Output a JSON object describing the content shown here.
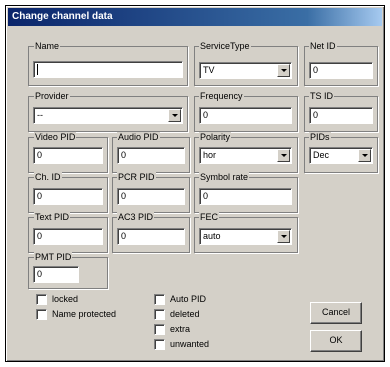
{
  "window": {
    "title": "Change channel data"
  },
  "fields": {
    "name": {
      "label": "Name",
      "value": ""
    },
    "service_type": {
      "label": "ServiceType",
      "value": "TV"
    },
    "net_id": {
      "label": "Net ID",
      "value": "0"
    },
    "provider": {
      "label": "Provider",
      "value": "--"
    },
    "frequency": {
      "label": "Frequency",
      "value": "0"
    },
    "ts_id": {
      "label": "TS ID",
      "value": "0"
    },
    "video_pid": {
      "label": "Video PID",
      "value": "0"
    },
    "audio_pid": {
      "label": "Audio PID",
      "value": "0"
    },
    "polarity": {
      "label": "Polarity",
      "value": "hor"
    },
    "pids": {
      "label": "PIDs",
      "value": "Dec"
    },
    "ch_id": {
      "label": "Ch. ID",
      "value": "0"
    },
    "pcr_pid": {
      "label": "PCR PID",
      "value": "0"
    },
    "symbol_rate": {
      "label": "Symbol rate",
      "value": "0"
    },
    "text_pid": {
      "label": "Text PID",
      "value": "0"
    },
    "ac3_pid": {
      "label": "AC3 PID",
      "value": "0"
    },
    "fec": {
      "label": "FEC",
      "value": "auto"
    },
    "pmt_pid": {
      "label": "PMT PID",
      "value": "0"
    }
  },
  "checkboxes": {
    "locked": {
      "label": "locked",
      "checked": false
    },
    "name_protected": {
      "label": "Name protected",
      "checked": false
    },
    "auto_pid": {
      "label": "Auto PID",
      "checked": false
    },
    "deleted": {
      "label": "deleted",
      "checked": false
    },
    "extra": {
      "label": "extra",
      "checked": false
    },
    "unwanted": {
      "label": "unwanted",
      "checked": false
    }
  },
  "buttons": {
    "cancel": "Cancel",
    "ok": "OK"
  }
}
